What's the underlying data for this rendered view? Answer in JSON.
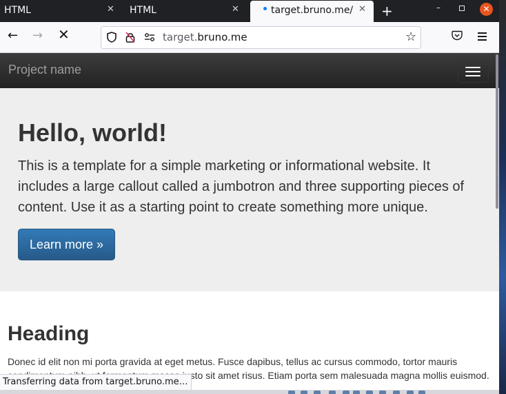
{
  "tabs": [
    {
      "title": "HTML",
      "close": "✕"
    },
    {
      "title": "HTML",
      "close": "✕"
    },
    {
      "title": "target.bruno.me/",
      "close": "✕",
      "active": true
    }
  ],
  "newtab": "+",
  "window": {
    "minimize": "–",
    "close": "✕"
  },
  "nav": {
    "back": "←",
    "forward": "→",
    "stop": "✕",
    "star": "☆"
  },
  "url": {
    "prefix": "target.",
    "domain": "bruno.me"
  },
  "site": {
    "brand": "Project name",
    "jumbotron": {
      "title": "Hello, world!",
      "text": "This is a template for a simple marketing or informational website. It includes a large callout called a jumbotron and three supporting pieces of content. Use it as a starting point to create something more unique.",
      "button": "Learn more »"
    },
    "section": {
      "heading": "Heading",
      "text": "Donec id elit non mi porta gravida at eget metus. Fusce dapibus, tellus ac cursus commodo, tortor mauris condimentum nibh, ut fermentum massa justo sit amet risus. Etiam porta sem malesuada magna mollis euismod."
    }
  },
  "status": "Transferring data from target.bruno.me…",
  "colors": {
    "accent": "#0a84ff",
    "button": "#337ab7",
    "close": "#e95420"
  },
  "icons": [
    "shield-icon",
    "lock-icon",
    "permissions-icon",
    "star-icon",
    "pocket-icon",
    "menu-icon"
  ]
}
